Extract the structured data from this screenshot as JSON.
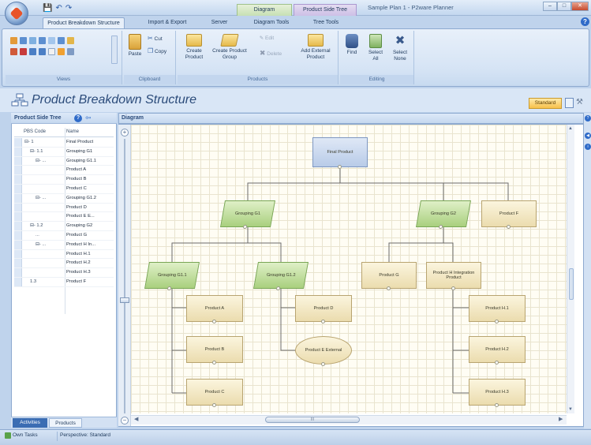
{
  "window": {
    "title": "Sample Plan 1 - P2ware Planner",
    "context_tab_diagram": "Diagram",
    "context_tab_pst": "Product Side Tree"
  },
  "ribbon_tabs": [
    {
      "label": "Product Breakdown Structure",
      "active": true
    },
    {
      "label": "Import & Export",
      "active": false
    },
    {
      "label": "Server",
      "active": false
    },
    {
      "label": "Diagram Tools",
      "active": false
    },
    {
      "label": "Tree Tools",
      "active": false
    }
  ],
  "ribbon": {
    "groups": {
      "views": "Views",
      "clipboard": "Clipboard",
      "products": "Products",
      "editing": "Editing"
    },
    "paste": "Paste",
    "cut": "Cut",
    "copy": "Copy",
    "create_product": "Create Product",
    "create_product_group": "Create Product Group",
    "edit": "Edit",
    "delete": "Delete",
    "add_external": "Add External Product",
    "find": "Find",
    "select_all": "Select All",
    "select_none": "Select None"
  },
  "page": {
    "title": "Product Breakdown Structure",
    "standard_button": "Standard"
  },
  "left_panel": {
    "title": "Product Side Tree",
    "col_code": "PBS Code",
    "col_name": "Name",
    "rows": [
      {
        "code": "⊟- 1",
        "name": "Final Product",
        "indent": 0
      },
      {
        "code": "⊟- 1.1",
        "name": "Grouping G1",
        "indent": 1
      },
      {
        "code": "⊟- ...",
        "name": "Grouping G1.1",
        "indent": 2
      },
      {
        "code": "",
        "name": "Product A",
        "indent": 3
      },
      {
        "code": "",
        "name": "Product B",
        "indent": 3
      },
      {
        "code": "",
        "name": "Product C",
        "indent": 3
      },
      {
        "code": "⊟- ...",
        "name": "Grouping G1.2",
        "indent": 2
      },
      {
        "code": "",
        "name": "Product D",
        "indent": 3
      },
      {
        "code": "",
        "name": "Product E E...",
        "indent": 3
      },
      {
        "code": "⊟- 1.2",
        "name": "Grouping G2",
        "indent": 1
      },
      {
        "code": "...",
        "name": "Product G",
        "indent": 2
      },
      {
        "code": "⊟- ...",
        "name": "Product H In...",
        "indent": 2
      },
      {
        "code": "",
        "name": "Product H.1",
        "indent": 3
      },
      {
        "code": "",
        "name": "Product H.2",
        "indent": 3
      },
      {
        "code": "",
        "name": "Product H.3",
        "indent": 3
      },
      {
        "code": "1.3",
        "name": "Product F",
        "indent": 1
      }
    ],
    "tabs": [
      "Activities",
      "Products"
    ]
  },
  "diagram": {
    "title": "Diagram",
    "nodes": {
      "final": "Final Product",
      "g1": "Grouping G1",
      "g2": "Grouping G2",
      "pf": "Product F",
      "g11": "Grouping G1.1",
      "g12": "Grouping G1.2",
      "pg": "Product G",
      "ph": "Product H Integration Product",
      "pa": "Product A",
      "pb": "Product B",
      "pc": "Product C",
      "pd": "Product D",
      "pe": "Product E External",
      "ph1": "Product H.1",
      "ph2": "Product H.2",
      "ph3": "Product H.3"
    },
    "scroll_label": "III"
  },
  "status": {
    "own_tasks": "Own Tasks",
    "perspective": "Perspective: Standard"
  }
}
